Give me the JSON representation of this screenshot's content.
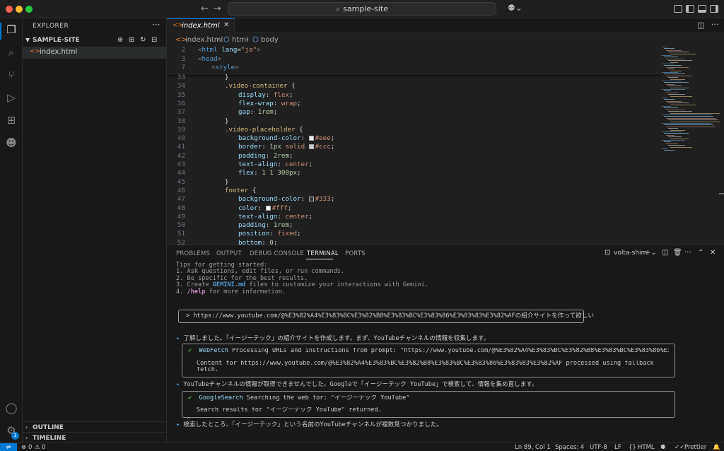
{
  "window": {
    "title": "sample-site"
  },
  "colors": {
    "accent": "#0078d4",
    "background": "#1f1f1f",
    "sidebar": "#181818"
  },
  "sidebar": {
    "title": "EXPLORER",
    "folder": "SAMPLE-SITE",
    "files": [
      {
        "name": "index.html",
        "icon": "html-file-icon"
      }
    ],
    "sections": [
      "OUTLINE",
      "TIMELINE"
    ]
  },
  "editor": {
    "tab": {
      "label": "index.html"
    },
    "breadcrumb": [
      "index.html",
      "html",
      "body"
    ],
    "sticky": [
      {
        "ln": "2",
        "html": "<span class='t-punc'>&lt;</span><span class='t-tag'>html</span> <span class='t-attr'>lang</span><span class='t-plain'>=</span><span class='t-str'>\"ja\"</span><span class='t-punc'>&gt;</span>",
        "indent": 0
      },
      {
        "ln": "3",
        "html": "<span class='t-punc'>&lt;</span><span class='t-tag'>head</span><span class='t-punc'>&gt;</span>",
        "indent": 0
      },
      {
        "ln": "7",
        "html": "<span class='t-punc'>&lt;</span><span class='t-tag'>style</span><span class='t-punc'>&gt;</span>",
        "indent": 1
      }
    ],
    "lines": [
      {
        "ln": "33",
        "indent": 2,
        "html": "<span class='t-plain'>}</span>"
      },
      {
        "ln": "34",
        "indent": 2,
        "html": "<span class='t-sel'>.video-container</span> <span class='t-plain'>{</span>"
      },
      {
        "ln": "35",
        "indent": 3,
        "html": "<span class='t-prop'>display</span><span class='t-plain'>: </span><span class='t-val'>flex</span><span class='t-plain'>;</span>"
      },
      {
        "ln": "36",
        "indent": 3,
        "html": "<span class='t-prop'>flex-wrap</span><span class='t-plain'>: </span><span class='t-val'>wrap</span><span class='t-plain'>;</span>"
      },
      {
        "ln": "37",
        "indent": 3,
        "html": "<span class='t-prop'>gap</span><span class='t-plain'>: </span><span class='t-num'>1rem</span><span class='t-plain'>;</span>"
      },
      {
        "ln": "38",
        "indent": 2,
        "html": "<span class='t-plain'>}</span>"
      },
      {
        "ln": "39",
        "indent": 2,
        "html": "<span class='t-sel'>.video-placeholder</span> <span class='t-plain'>{</span>"
      },
      {
        "ln": "40",
        "indent": 3,
        "html": "<span class='t-prop'>background-color</span><span class='t-plain'>: </span><span class='swatch' style='background:#eee'></span><span class='t-val'>#eee</span><span class='t-plain'>;</span>"
      },
      {
        "ln": "41",
        "indent": 3,
        "html": "<span class='t-prop'>border</span><span class='t-plain'>: </span><span class='t-num'>1px</span> <span class='t-val'>solid</span> <span class='swatch' style='background:#ccc'></span><span class='t-val'>#ccc</span><span class='t-plain'>;</span>"
      },
      {
        "ln": "42",
        "indent": 3,
        "html": "<span class='t-prop'>padding</span><span class='t-plain'>: </span><span class='t-num'>2rem</span><span class='t-plain'>;</span>"
      },
      {
        "ln": "43",
        "indent": 3,
        "html": "<span class='t-prop'>text-align</span><span class='t-plain'>: </span><span class='t-val'>center</span><span class='t-plain'>;</span>"
      },
      {
        "ln": "44",
        "indent": 3,
        "html": "<span class='t-prop'>flex</span><span class='t-plain'>: </span><span class='t-num'>1 1 300px</span><span class='t-plain'>;</span>"
      },
      {
        "ln": "45",
        "indent": 2,
        "html": "<span class='t-plain'>}</span>"
      },
      {
        "ln": "46",
        "indent": 2,
        "html": "<span class='t-sel'>footer</span> <span class='t-plain'>{</span>"
      },
      {
        "ln": "47",
        "indent": 3,
        "html": "<span class='t-prop'>background-color</span><span class='t-plain'>: </span><span class='swatch' style='background:#333'></span><span class='t-val'>#333</span><span class='t-plain'>;</span>"
      },
      {
        "ln": "48",
        "indent": 3,
        "html": "<span class='t-prop'>color</span><span class='t-plain'>: </span><span class='swatch' style='background:#fff'></span><span class='t-val'>#fff</span><span class='t-plain'>;</span>"
      },
      {
        "ln": "49",
        "indent": 3,
        "html": "<span class='t-prop'>text-align</span><span class='t-plain'>: </span><span class='t-val'>center</span><span class='t-plain'>;</span>"
      },
      {
        "ln": "50",
        "indent": 3,
        "html": "<span class='t-prop'>padding</span><span class='t-plain'>: </span><span class='t-num'>1rem</span><span class='t-plain'>;</span>"
      },
      {
        "ln": "51",
        "indent": 3,
        "html": "<span class='t-prop'>position</span><span class='t-plain'>: </span><span class='t-val'>fixed</span><span class='t-plain'>;</span>"
      },
      {
        "ln": "52",
        "indent": 3,
        "html": "<span class='t-prop'>bottom</span><span class='t-plain'>: </span><span class='t-num'>0</span><span class='t-plain'>;</span>"
      }
    ]
  },
  "panel": {
    "tabs": [
      "PROBLEMS",
      "OUTPUT",
      "DEBUG CONSOLE",
      "TERMINAL",
      "PORTS"
    ],
    "active_tab": "TERMINAL",
    "terminal_name": "volta-shim",
    "terminal": {
      "tips_header": "Tips for getting started:",
      "tip1": "1. Ask questions, edit files, or run commands.",
      "tip2": "2. Be specific for the best results.",
      "tip3_pre": "3. Create ",
      "tip3_hl": "GEMINI.md",
      "tip3_post": " files to customize your interactions with Gemini.",
      "tip4_pre": "4. ",
      "tip4_hl": "/help",
      "tip4_post": " for more information.",
      "prompt": "> https://www.youtube.com/@%E3%82%A4%E3%83%BC%E3%82%B8%E3%83%BC%E3%83%86%E3%83%83%E3%82%AFの紹介サイトを作って欲しい",
      "msg1": "了解しました。「イージーテック」の紹介サイトを作成します。まず、YouTubeチャンネルの情報を収集します。",
      "tool1_name": "WebFetch",
      "tool1_desc": " Processing URLs and instructions from prompt: \"https://www.youtube.com/@%E3%82%A4%E3%83%BC%E3%82%B8%E3%83%BC%E3%83%86%E3%83%83%E3%...",
      "tool1_result1": "Content for https://www.youtube.com/@%E3%82%A4%E3%83%BC%E3%82%B8%E3%83%BC%E3%83%86%E3%83%83%E3%82%AF processed using fallback",
      "tool1_result2": "fetch.",
      "msg2": "YouTubeチャンネルの情報が取得できませんでした。Googleで「イージーテック YouTube」で検索して、情報を集め直します。",
      "tool2_name": "GoogleSearch",
      "tool2_desc": " Searching the web for: \"イージーテック YouTube\"",
      "tool2_result": "Search results for \"イージーテック YouTube\" returned.",
      "msg3": "検索したところ、「イージーテック」という名前のYouTubeチャンネルが複数見つかりました。"
    }
  },
  "statusbar": {
    "errors": "0",
    "warnings": "0",
    "position": "Ln 89, Col 1",
    "spaces": "Spaces: 4",
    "encoding": "UTF-8",
    "eol": "LF",
    "language": "HTML",
    "formatter": "Prettier",
    "badge": "1"
  }
}
